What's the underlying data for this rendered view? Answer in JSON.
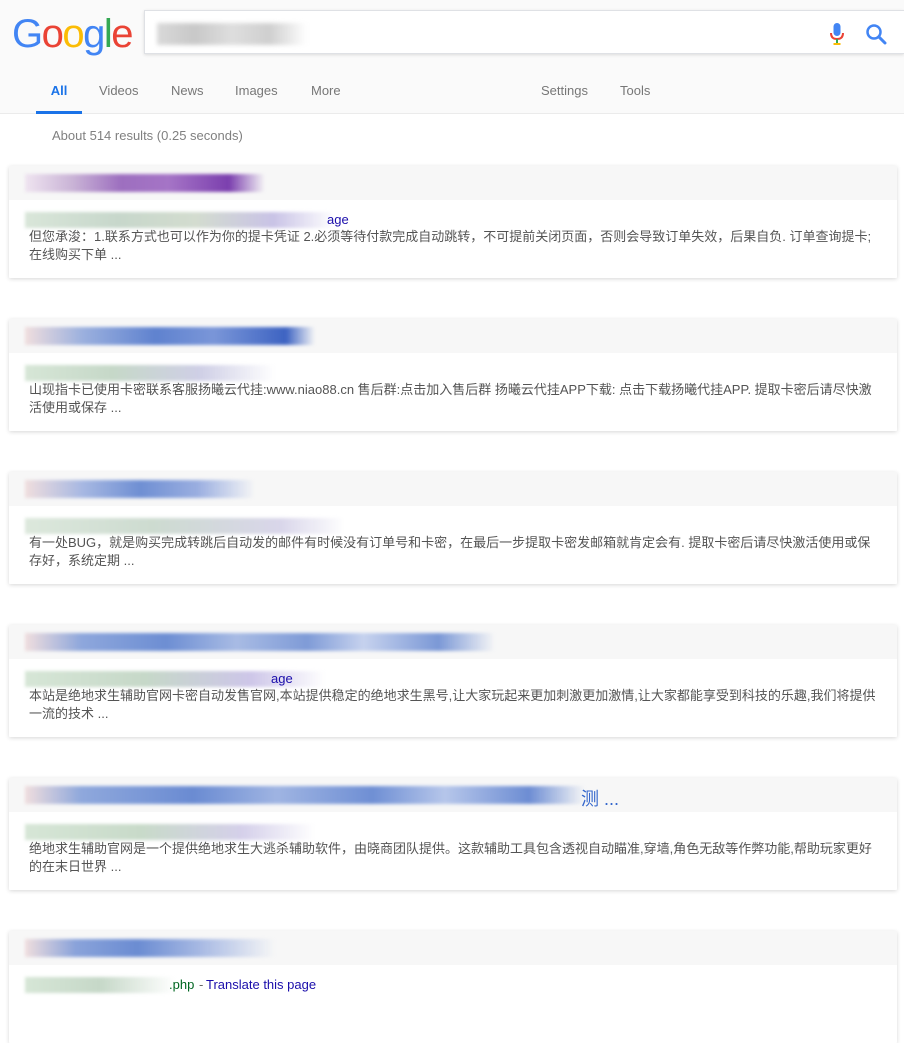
{
  "logo": {
    "letters": [
      "G",
      "o",
      "o",
      "g",
      "l",
      "e"
    ],
    "colors": [
      "#4285F4",
      "#EA4335",
      "#FBBC05",
      "#4285F4",
      "#34A853",
      "#EA4335"
    ]
  },
  "search": {
    "value": "",
    "placeholder": ""
  },
  "tabs": {
    "all": "All",
    "videos": "Videos",
    "news": "News",
    "images": "Images",
    "more": "More",
    "settings": "Settings",
    "tools": "Tools"
  },
  "stats": "About 514 results (0.25 seconds)",
  "results": [
    {
      "title": "",
      "url_suffix": "age",
      "snippet": "但您承浚：1.联系方式也可以作为你的提卡凭证 2.必须等待付款完成自动跳转，不可提前关闭页面，否则会导致订单失效，后果自负. 订单查询提卡; 在线购买下单 ..."
    },
    {
      "title": "",
      "url_suffix": "",
      "snippet": "山现指卡已使用卡密联系客服扬曦云代挂:www.niao88.cn 售后群:点击加入售后群 扬曦云代挂APP下载: 点击下载扬曦代挂APP. 提取卡密后请尽快激活使用或保存 ..."
    },
    {
      "title": "",
      "url_suffix": "",
      "snippet": "有一处BUG，就是购买完成转跳后自动发的邮件有时候没有订单号和卡密，在最后一步提取卡密发邮箱就肯定会有. 提取卡密后请尽快激活使用或保存好，系统定期 ..."
    },
    {
      "title": "",
      "url_suffix": "age",
      "snippet": "本站是绝地求生辅助官网卡密自动发售官网,本站提供稳定的绝地求生黑号,让大家玩起来更加刺激更加激情,让大家都能享受到科技的乐趣,我们将提供一流的技术 ..."
    },
    {
      "title": "测 ...",
      "url_suffix": "",
      "snippet": "绝地求生辅助官网是一个提供绝地求生大逃杀辅助软件，由晓商团队提供。这款辅助工具包含透视自动瞄准,穿墙,角色无敌等作弊功能,帮助玩家更好的在末日世界 ..."
    },
    {
      "title": "",
      "url_suffix": ".php",
      "translate": "Translate this page",
      "snippet": ""
    }
  ]
}
